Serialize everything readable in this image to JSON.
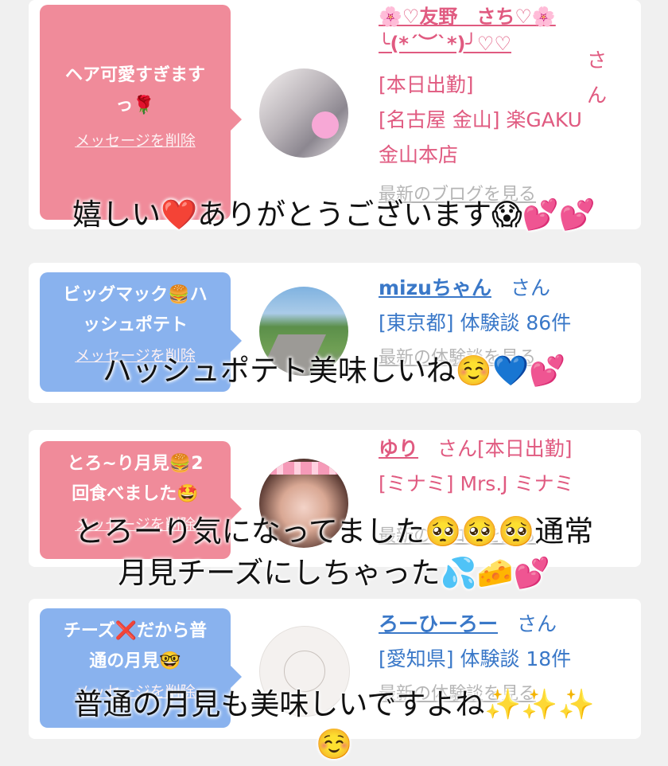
{
  "cards": [
    {
      "bubble_text": "ヘア可愛すぎます\nっ🌹",
      "delete_label": "メッセージを削除",
      "name": "🌸♡友野　さち♡🌸\n╰(*´︶`*)╯♡♡",
      "honorific": "さん",
      "lines": [
        "[本日出勤]",
        "[名古屋 金山] 楽GAKU",
        "金山本店"
      ],
      "link": "最新のブログを見る"
    },
    {
      "bubble_text": "ビッグマック🍔ハ\nッシュポテト",
      "delete_label": "メッセージを削除",
      "name": "mizuちゃん",
      "honorific": "さん",
      "lines": [
        "[東京都] 体験談 86件"
      ],
      "link": "最新の体験談を見る"
    },
    {
      "bubble_text": "とろ~り月見🍔2\n回食べました🤩",
      "delete_label": "メッセージを削除",
      "name": "ゆり",
      "honorific": "さん[本日出勤]",
      "lines": [
        "[ミナミ] Mrs.J ミナミ"
      ],
      "link": "最新のブログを見る"
    },
    {
      "bubble_text": "チーズ❌だから普\n通の月見🤓",
      "delete_label": "メッセージを削除",
      "name": "ろーひーろー",
      "honorific": "さん",
      "lines": [
        "[愛知県] 体験談 18件"
      ],
      "link": "最新の体験談を見る"
    }
  ],
  "captions": [
    "嬉しい❤️ありがとうございます😱💕💕",
    "ハッシュポテト美味しいね☺️💙💕",
    "とろーり気になってました🥺🥺🥺通常\n月見チーズにしちゃった💦🧀💕",
    "普通の月見も美味しいですよね✨✨✨\n☺️"
  ],
  "colors": {
    "pink_bubble": "#f08b9a",
    "blue_bubble": "#89b2ee",
    "pink_text": "#e05a80",
    "blue_text": "#3a78c8"
  }
}
